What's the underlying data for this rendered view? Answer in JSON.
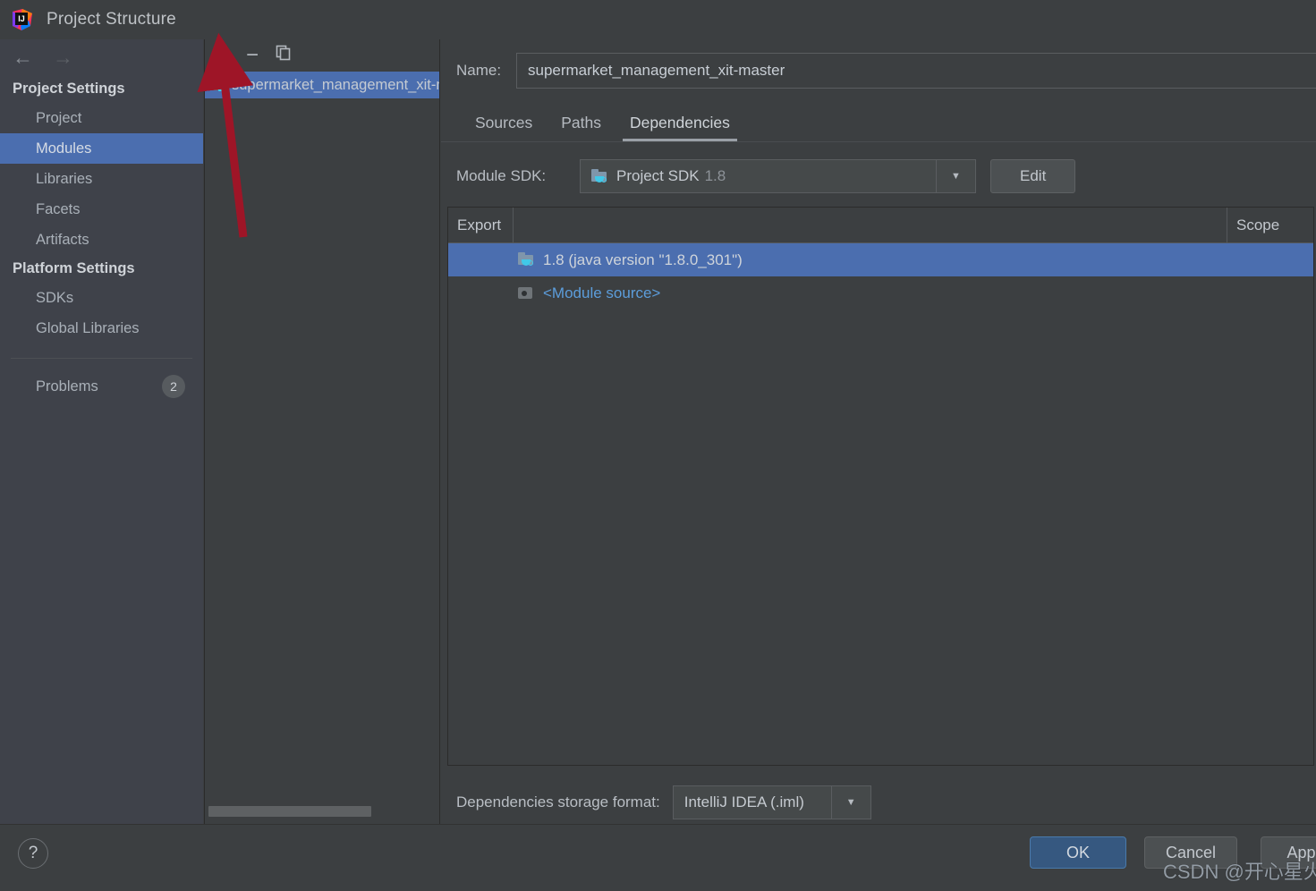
{
  "window": {
    "title": "Project Structure",
    "app_icon": "intellij-idea-logo"
  },
  "sidebar": {
    "nav": {
      "back_icon": "arrow-left-icon",
      "forward_icon": "arrow-right-icon"
    },
    "groups": [
      {
        "title": "Project Settings",
        "items": [
          {
            "label": "Project",
            "selected": false
          },
          {
            "label": "Modules",
            "selected": true
          },
          {
            "label": "Libraries",
            "selected": false
          },
          {
            "label": "Facets",
            "selected": false
          },
          {
            "label": "Artifacts",
            "selected": false
          }
        ]
      },
      {
        "title": "Platform Settings",
        "items": [
          {
            "label": "SDKs",
            "selected": false
          },
          {
            "label": "Global Libraries",
            "selected": false
          }
        ]
      }
    ],
    "problems": {
      "label": "Problems",
      "count": "2"
    }
  },
  "module_tree": {
    "toolbar": {
      "add": "+",
      "remove": "−",
      "copy": "⎘"
    },
    "items": [
      {
        "label": "supermarket_management_xit-master",
        "selected": true
      }
    ]
  },
  "main": {
    "name_label": "Name:",
    "name_value": "supermarket_management_xit-master",
    "tabs": [
      {
        "label": "Sources",
        "active": false
      },
      {
        "label": "Paths",
        "active": false
      },
      {
        "label": "Dependencies",
        "active": true
      }
    ],
    "module_sdk": {
      "label": "Module SDK:",
      "value": "Project SDK",
      "value_suffix": "1.8",
      "edit_label": "Edit"
    },
    "table": {
      "columns": [
        "Export",
        "",
        "Scope"
      ],
      "rows": [
        {
          "name": "1.8 (java version \"1.8.0_301\")",
          "scope": "",
          "selected": true,
          "icon": "jdk-folder-icon"
        },
        {
          "name": "<Module source>",
          "scope": "",
          "selected": false,
          "icon": "module-source-icon"
        }
      ]
    },
    "storage": {
      "label": "Dependencies storage format:",
      "value": "IntelliJ IDEA (.iml)"
    }
  },
  "footer": {
    "help_label": "?",
    "ok_label": "OK",
    "cancel_label": "Cancel",
    "apply_label": "Apply"
  },
  "annotations": {
    "watermark": "CSDN @开心星火",
    "arrow_color": "#9e1527"
  },
  "colors": {
    "window_bg": "#3c3f41",
    "sidebar_bg": "#3f424a",
    "selection_blue": "#4b6eaf",
    "link_blue": "#5c9ddb",
    "ok_button": "#365880"
  }
}
